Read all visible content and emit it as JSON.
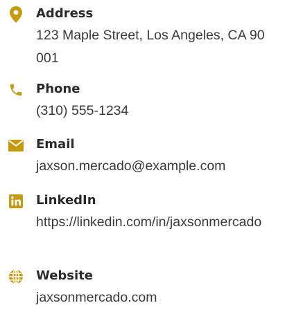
{
  "accent_color": "#c59a0e",
  "contacts": [
    {
      "icon": "map-marker-icon",
      "label": "Address",
      "value": "123 Maple Street, Los Angeles, CA 90001"
    },
    {
      "icon": "phone-icon",
      "label": "Phone",
      "value": "(310) 555-1234"
    },
    {
      "icon": "envelope-icon",
      "label": "Email",
      "value": "jaxson.mercado@example.com"
    },
    {
      "icon": "linkedin-icon",
      "label": "LinkedIn",
      "value": "https://linkedin.com/in/jaxsonmercado"
    },
    {
      "icon": "globe-icon",
      "label": "Website",
      "value": "jaxsonmercado.com"
    }
  ]
}
